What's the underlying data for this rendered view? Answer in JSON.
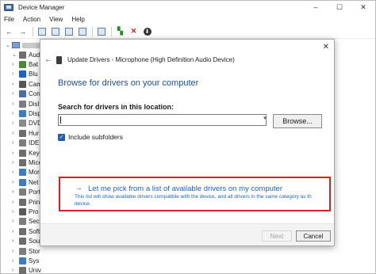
{
  "window": {
    "title": "Device Manager",
    "controls": {
      "minimize": "–",
      "maximize": "☐",
      "close": "✕"
    }
  },
  "menu": [
    "File",
    "Action",
    "View",
    "Help"
  ],
  "tree": {
    "items": [
      {
        "label": "Aud",
        "icon": "speaker-icon",
        "color": "#6d6d6d",
        "expanded": true
      },
      {
        "label": "Bat",
        "icon": "battery-icon",
        "color": "#4a8a3a",
        "expanded": false
      },
      {
        "label": "Blu",
        "icon": "bluetooth-icon",
        "color": "#1e62c9",
        "expanded": false
      },
      {
        "label": "Cam",
        "icon": "camera-icon",
        "color": "#555555",
        "expanded": false
      },
      {
        "label": "Con",
        "icon": "computer-icon",
        "color": "#4a6fa5",
        "expanded": false
      },
      {
        "label": "Disl",
        "icon": "disk-icon",
        "color": "#7d7d7d",
        "expanded": false
      },
      {
        "label": "Disp",
        "icon": "display-icon",
        "color": "#3f7bbf",
        "expanded": false
      },
      {
        "label": "DVD",
        "icon": "dvd-icon",
        "color": "#8a8a8a",
        "expanded": false
      },
      {
        "label": "Hur",
        "icon": "hid-icon",
        "color": "#6d6d6d",
        "expanded": false
      },
      {
        "label": "IDE",
        "icon": "ide-icon",
        "color": "#7d7d7d",
        "expanded": false
      },
      {
        "label": "Key",
        "icon": "keyboard-icon",
        "color": "#6d6d6d",
        "expanded": false
      },
      {
        "label": "Mice",
        "icon": "mouse-icon",
        "color": "#6d6d6d",
        "expanded": false
      },
      {
        "label": "Mor",
        "icon": "monitor-icon",
        "color": "#3f7bbf",
        "expanded": false
      },
      {
        "label": "Net",
        "icon": "network-icon",
        "color": "#3f7bbf",
        "expanded": false
      },
      {
        "label": "Port",
        "icon": "port-icon",
        "color": "#7d7d7d",
        "expanded": false
      },
      {
        "label": "Prin",
        "icon": "printer-icon",
        "color": "#6d6d6d",
        "expanded": false
      },
      {
        "label": "Pro",
        "icon": "processor-icon",
        "color": "#5a5a5a",
        "expanded": false
      },
      {
        "label": "Sec",
        "icon": "security-icon",
        "color": "#7d7d7d",
        "expanded": false
      },
      {
        "label": "Soft",
        "icon": "software-icon",
        "color": "#6d6d6d",
        "expanded": false
      },
      {
        "label": "Sou",
        "icon": "sound-icon",
        "color": "#6d6d6d",
        "expanded": false
      },
      {
        "label": "Stor",
        "icon": "storage-icon",
        "color": "#7d7d7d",
        "expanded": false
      },
      {
        "label": "Sys",
        "icon": "system-icon",
        "color": "#3f7bbf",
        "expanded": false
      },
      {
        "label": "Univ",
        "icon": "usb-icon",
        "color": "#6d6d6d",
        "expanded": false
      }
    ]
  },
  "dialog": {
    "title": "Update Drivers - Microphone (High Definition Audio Device)",
    "close": "✕",
    "heading": "Browse for drivers on your computer",
    "search_label": "Search for drivers in this location:",
    "path_value": "",
    "browse_label": "Browse...",
    "include_subfolders_label": "Include subfolders",
    "include_subfolders_checked": true,
    "pick_title": "Let me pick from a list of available drivers on my computer",
    "pick_desc_line1": "This list will show available drivers compatible with the device, and all drivers in the same category as th",
    "pick_desc_line2": "device.",
    "next_label": "Next",
    "cancel_label": "Cancel"
  },
  "colors": {
    "link_blue": "#1e62c9",
    "heading_blue": "#1e4e99",
    "highlight_red": "#d32020",
    "checkbox_blue": "#1e5fb4"
  }
}
